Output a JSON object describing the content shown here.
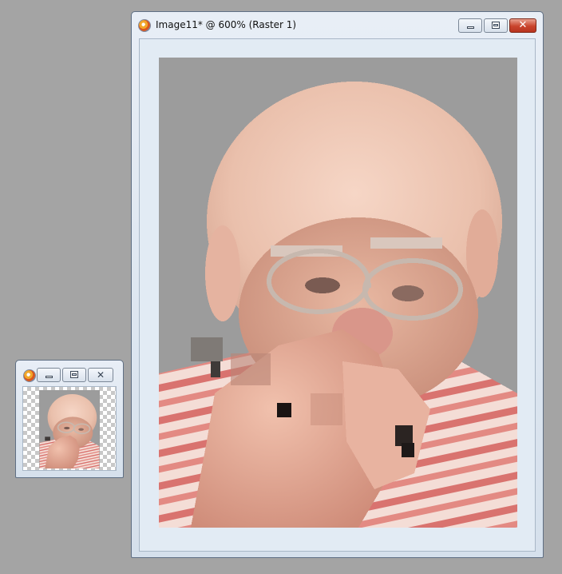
{
  "main_window": {
    "title": "Image11* @ 600% (Raster 1)",
    "minimize_label": "",
    "restore_label": "",
    "close_label": "✕"
  },
  "overview_window": {
    "minimize_label": "",
    "restore_label": "",
    "close_label": "✕"
  },
  "canvas": {
    "subject": "pixelated photo of an elderly man with glasses playing a harmonica",
    "background_color": "#9c9c9c"
  },
  "colors": {
    "desktop": "#a4a4a4",
    "window_frame": "#d5e0ec",
    "close_button": "#c9442c"
  }
}
